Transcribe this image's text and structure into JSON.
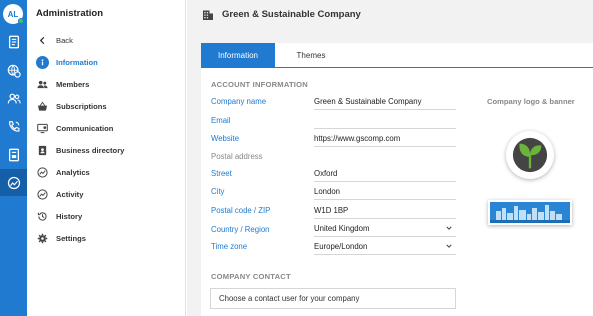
{
  "rail": {
    "avatar_initials": "AL",
    "icons": [
      "document-icon",
      "globe-settings-icon",
      "users-icon",
      "phone-icon",
      "report-icon",
      "admin-icon"
    ]
  },
  "sidebar": {
    "title": "Administration",
    "back_label": "Back",
    "items": [
      {
        "label": "Information",
        "icon": "info-icon",
        "active": true
      },
      {
        "label": "Members",
        "icon": "members-icon"
      },
      {
        "label": "Subscriptions",
        "icon": "basket-icon"
      },
      {
        "label": "Communication",
        "icon": "communication-icon"
      },
      {
        "label": "Business directory",
        "icon": "directory-icon"
      },
      {
        "label": "Analytics",
        "icon": "analytics-icon"
      },
      {
        "label": "Activity",
        "icon": "activity-icon"
      },
      {
        "label": "History",
        "icon": "history-icon"
      },
      {
        "label": "Settings",
        "icon": "gear-icon"
      }
    ]
  },
  "header": {
    "title": "Green & Sustainable Company"
  },
  "tabs": [
    {
      "label": "Information",
      "active": true
    },
    {
      "label": "Themes",
      "active": false
    }
  ],
  "account": {
    "section_title": "ACCOUNT INFORMATION",
    "company_name_label": "Company name",
    "company_name_value": "Green & Sustainable Company",
    "email_label": "Email",
    "email_value": "",
    "website_label": "Website",
    "website_value": "https://www.gscomp.com",
    "postal_address_label": "Postal address",
    "street_label": "Street",
    "street_value": "Oxford",
    "city_label": "City",
    "city_value": "London",
    "postal_code_label": "Postal code / ZIP",
    "postal_code_value": "W1D 1BP",
    "country_label": "Country / Region",
    "country_value": "United Kingdom",
    "timezone_label": "Time zone",
    "timezone_value": "Europe/London"
  },
  "logo": {
    "label": "Company logo & banner"
  },
  "contact": {
    "section_title": "COMPANY CONTACT",
    "placeholder": "Choose a contact user for your company"
  },
  "colors": {
    "accent": "#1f7ad0",
    "rail": "#1f7ad0",
    "logo_green": "#6ab43a",
    "banner_blue": "#2a86d4"
  }
}
